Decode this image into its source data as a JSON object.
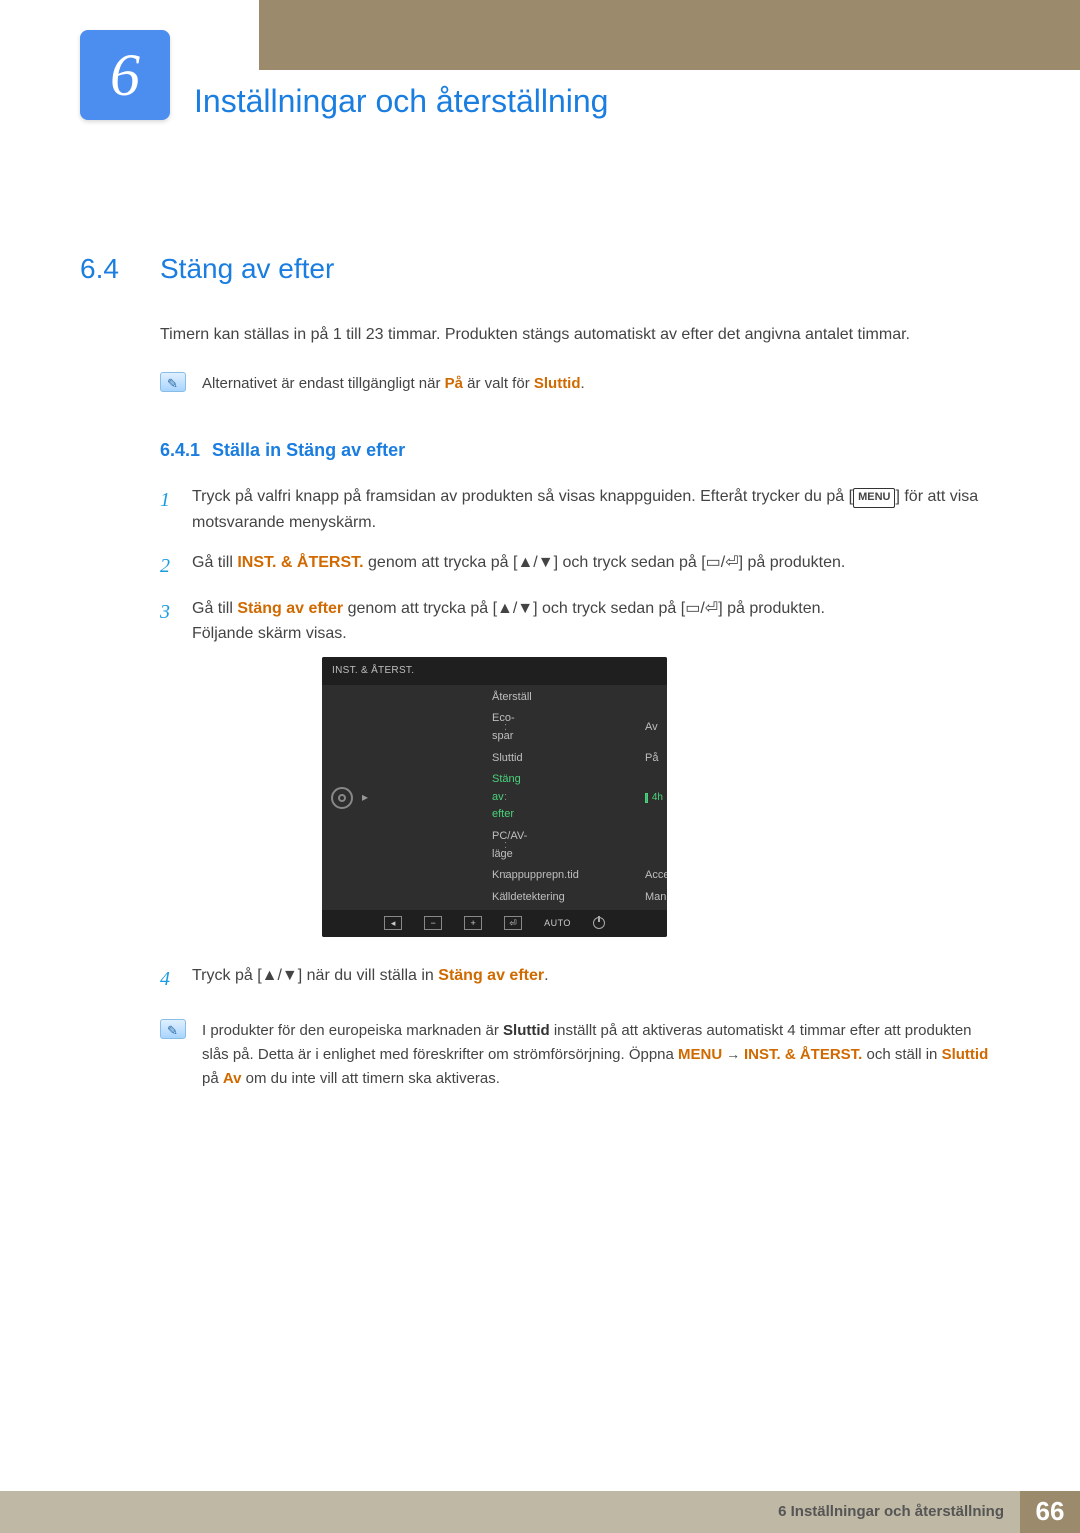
{
  "header": {
    "chapter_number": "6",
    "chapter_title": "Inställningar och återställning"
  },
  "section": {
    "number": "6.4",
    "title": "Stäng av efter",
    "intro": "Timern kan ställas in på 1 till 23 timmar. Produkten stängs automatiskt av efter det angivna antalet timmar."
  },
  "note1": {
    "prefix": "Alternativet är endast tillgängligt när ",
    "hi1": "På",
    "mid": " är valt för ",
    "hi2": "Sluttid",
    "suffix": "."
  },
  "subsection": {
    "number": "6.4.1",
    "title": "Ställa in Stäng av efter"
  },
  "steps": {
    "s1a": "Tryck på valfri knapp på framsidan av produkten så visas knappguiden. Efteråt trycker du på [",
    "s1_menulabel": "MENU",
    "s1b": "] för att visa motsvarande menyskärm.",
    "s2a": "Gå till ",
    "s2_hi": "INST. & ÅTERST.",
    "s2b": " genom att trycka på [",
    "s2c": "] och tryck sedan på [",
    "s2d": "] på produkten.",
    "s3a": "Gå till ",
    "s3_hi": "Stäng av efter",
    "s3b": " genom att trycka på [",
    "s3c": "] och tryck sedan på [",
    "s3d": "] på produkten.",
    "s3e": "Följande skärm visas.",
    "s4a": "Tryck på [",
    "s4b": "] när du vill ställa in ",
    "s4_hi": "Stäng av efter",
    "s4c": "."
  },
  "monitor": {
    "title": "INST. & ÅTERST.",
    "rows": [
      {
        "label": "Återställ",
        "val": ""
      },
      {
        "label": "Eco-spar",
        "val": "Av"
      },
      {
        "label": "Sluttid",
        "val": "På"
      },
      {
        "label": "Stäng av efter",
        "val": "4h",
        "active": true,
        "slider": true
      },
      {
        "label": "PC/AV-läge",
        "val": ""
      },
      {
        "label": "Knappupprepn.tid",
        "val": "Acceleration"
      },
      {
        "label": "Källdetektering",
        "val": "Manuellt"
      }
    ],
    "foot_auto": "AUTO"
  },
  "note2": {
    "a": "I produkter för den europeiska marknaden är ",
    "b_bold": "Sluttid",
    "c": " inställt på att aktiveras automatiskt 4 timmar efter att produkten slås på. Detta är i enlighet med föreskrifter om strömförsörjning. Öppna ",
    "d_hi": "MENU",
    "arrow": " → ",
    "e_hi": "INST. & ÅTERST.",
    "f": " och ställ in ",
    "g_hi": "Sluttid",
    "h": " på ",
    "i_hi": "Av",
    "j": " om du inte vill att timern ska aktiveras."
  },
  "footer": {
    "text": "6 Inställningar och återställning",
    "page": "66"
  }
}
